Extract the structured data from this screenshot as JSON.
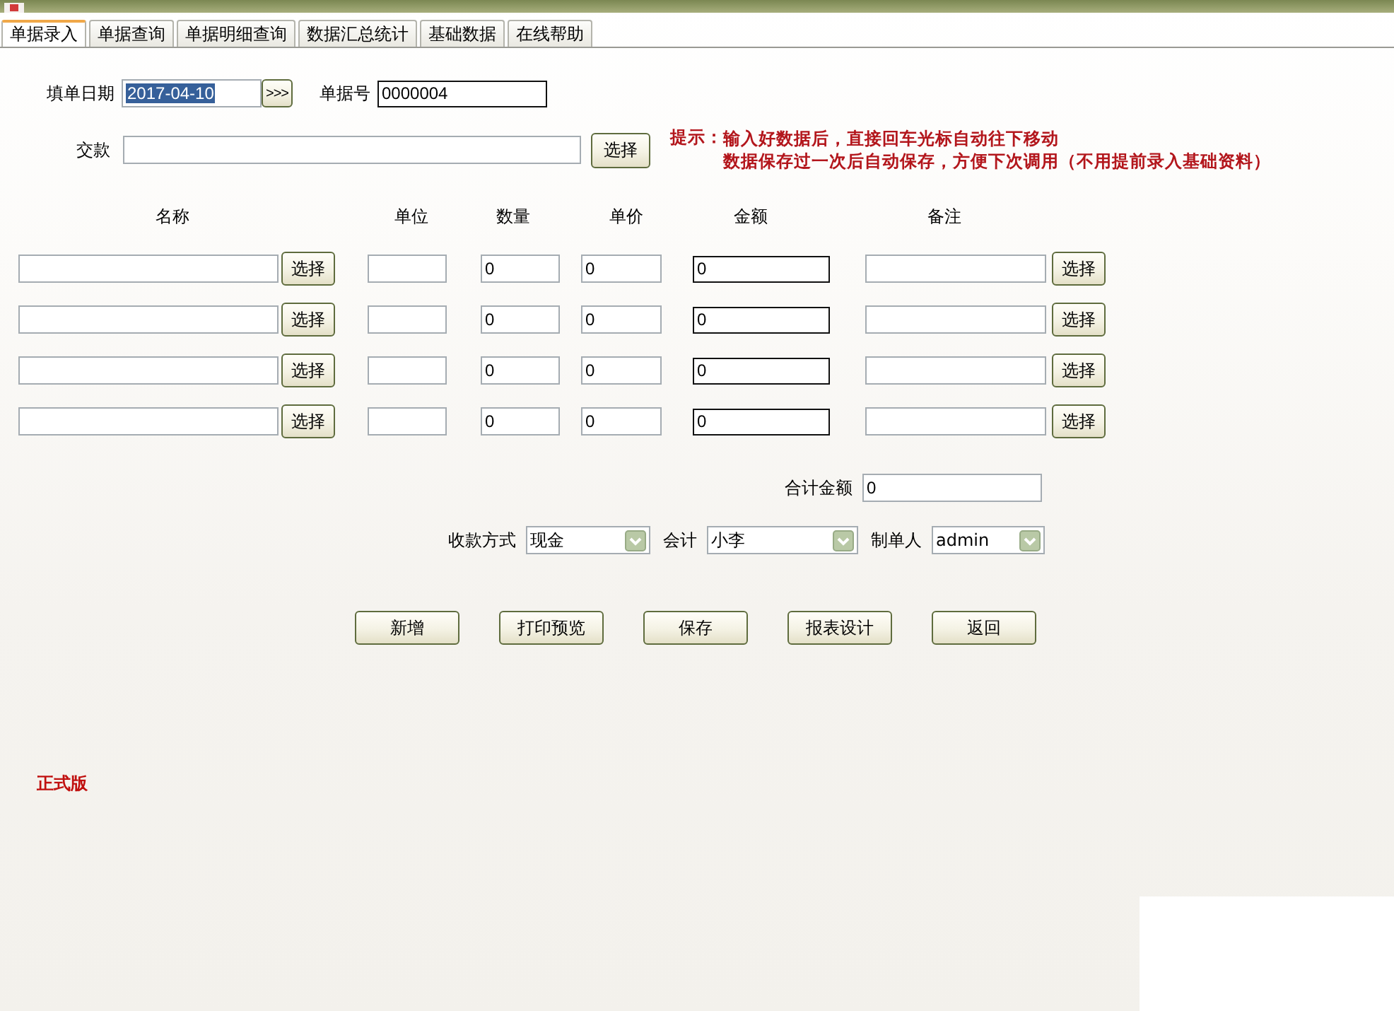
{
  "tabs": [
    {
      "label": "单据录入",
      "selected": true
    },
    {
      "label": "单据查询",
      "selected": false
    },
    {
      "label": "单据明细查询",
      "selected": false
    },
    {
      "label": "数据汇总统计",
      "selected": false
    },
    {
      "label": "基础数据",
      "selected": false
    },
    {
      "label": "在线帮助",
      "selected": false
    }
  ],
  "form": {
    "date": {
      "label": "填单日期",
      "value": "2017-04-10",
      "text_selected": true,
      "picker_button": ">>>"
    },
    "bill_number": {
      "label": "单据号",
      "value": "0000004"
    },
    "payer": {
      "label": "交款",
      "button": "选择"
    }
  },
  "hint": {
    "label": "提示：",
    "lines": [
      "输入好数据后，直接回车光标自动往下移动",
      "数据保存过一次后自动保存，方便下次调用（不用提前录入基础资料）"
    ]
  },
  "table": {
    "columns": [
      "名称",
      "单位",
      "数量",
      "单价",
      "金额",
      "备注"
    ],
    "rows": [
      {
        "name_button": "选择",
        "quantity": "0",
        "price": "0",
        "amount": "0",
        "note_button": "选择"
      },
      {
        "name_button": "选择",
        "quantity": "0",
        "price": "0",
        "amount": "0",
        "note_button": "选择"
      },
      {
        "name_button": "选择",
        "quantity": "0",
        "price": "0",
        "amount": "0",
        "note_button": "选择"
      },
      {
        "name_button": "选择",
        "quantity": "0",
        "price": "0",
        "amount": "0",
        "note_button": "选择"
      }
    ]
  },
  "total": {
    "label": "合计金额",
    "value": "0"
  },
  "selects": [
    {
      "label": "收款方式",
      "value": "现金"
    },
    {
      "label": "会计",
      "value": "小李"
    },
    {
      "label": "制单人",
      "value": "admin"
    }
  ],
  "buttons": [
    "新增",
    "打印预览",
    "保存",
    "报表设计",
    "返回"
  ],
  "edition": "正式版"
}
